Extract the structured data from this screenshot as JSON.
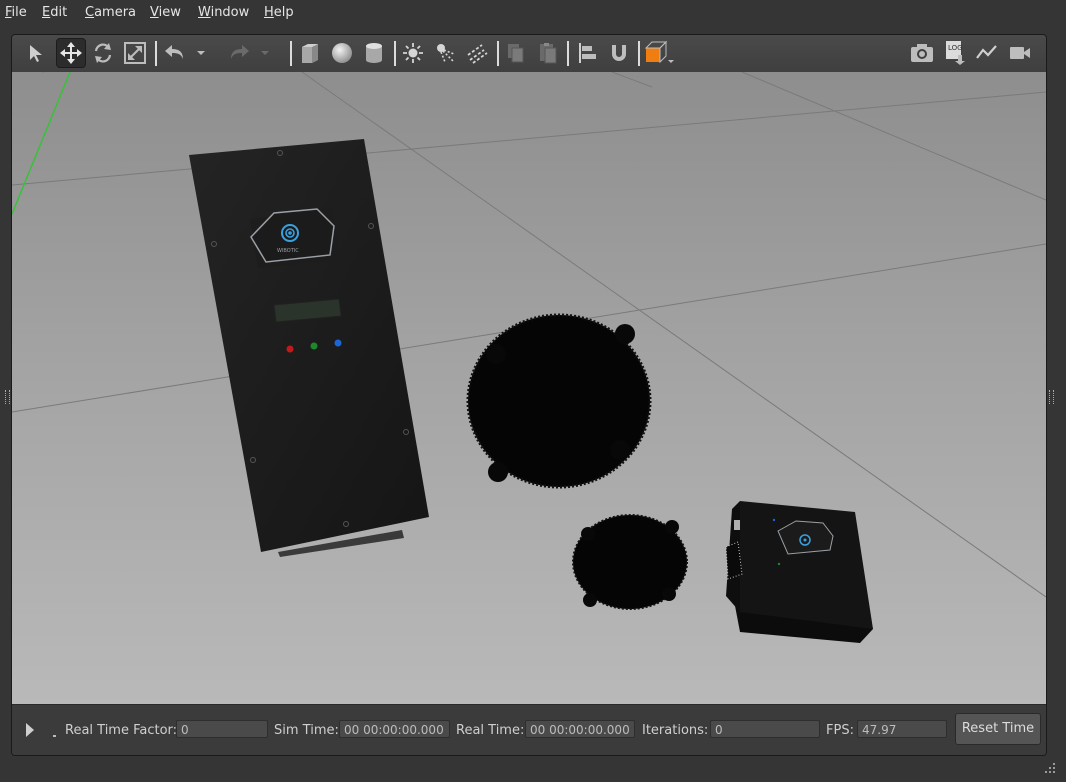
{
  "menu": {
    "file": {
      "m": "F",
      "rest": "ile"
    },
    "edit": {
      "m": "E",
      "rest": "dit"
    },
    "camera": {
      "m": "C",
      "rest": "amera"
    },
    "view": {
      "m": "V",
      "rest": "iew"
    },
    "window": {
      "m": "W",
      "rest": "indow"
    },
    "help": {
      "m": "H",
      "rest": "elp"
    }
  },
  "toolbar": {
    "icons": [
      "select-arrow-icon",
      "translate-icon",
      "rotate-icon",
      "scale-icon",
      "undo-icon",
      "undo-history-icon",
      "redo-icon",
      "redo-history-icon",
      "box-icon",
      "sphere-icon",
      "cylinder-icon",
      "point-light-icon",
      "spot-light-icon",
      "directional-light-icon",
      "copy-icon",
      "paste-icon",
      "align-icon",
      "snap-icon",
      "view-angle-icon",
      "screenshot-icon",
      "log-icon",
      "plot-icon",
      "record-video-icon"
    ],
    "log_label": "LOG",
    "active_tool": "translate"
  },
  "scene": {
    "logo_text": "WIBOTIC",
    "led_colors": [
      "#c01a1a",
      "#1a8a2a",
      "#1a66d8"
    ]
  },
  "status": {
    "real_time_factor_label": "Real Time Factor:",
    "real_time_factor_value": "0",
    "sim_time_label": "Sim Time:",
    "sim_time_value": "00 00:00:00.000",
    "real_time_label": "Real Time:",
    "real_time_value": "00 00:00:00.000",
    "iterations_label": "Iterations:",
    "iterations_value": "0",
    "fps_label": "FPS:",
    "fps_value": "47.97",
    "reset_button": "Reset Time"
  },
  "colors": {
    "accent_orange": "#f07d10",
    "background": "#353535"
  }
}
